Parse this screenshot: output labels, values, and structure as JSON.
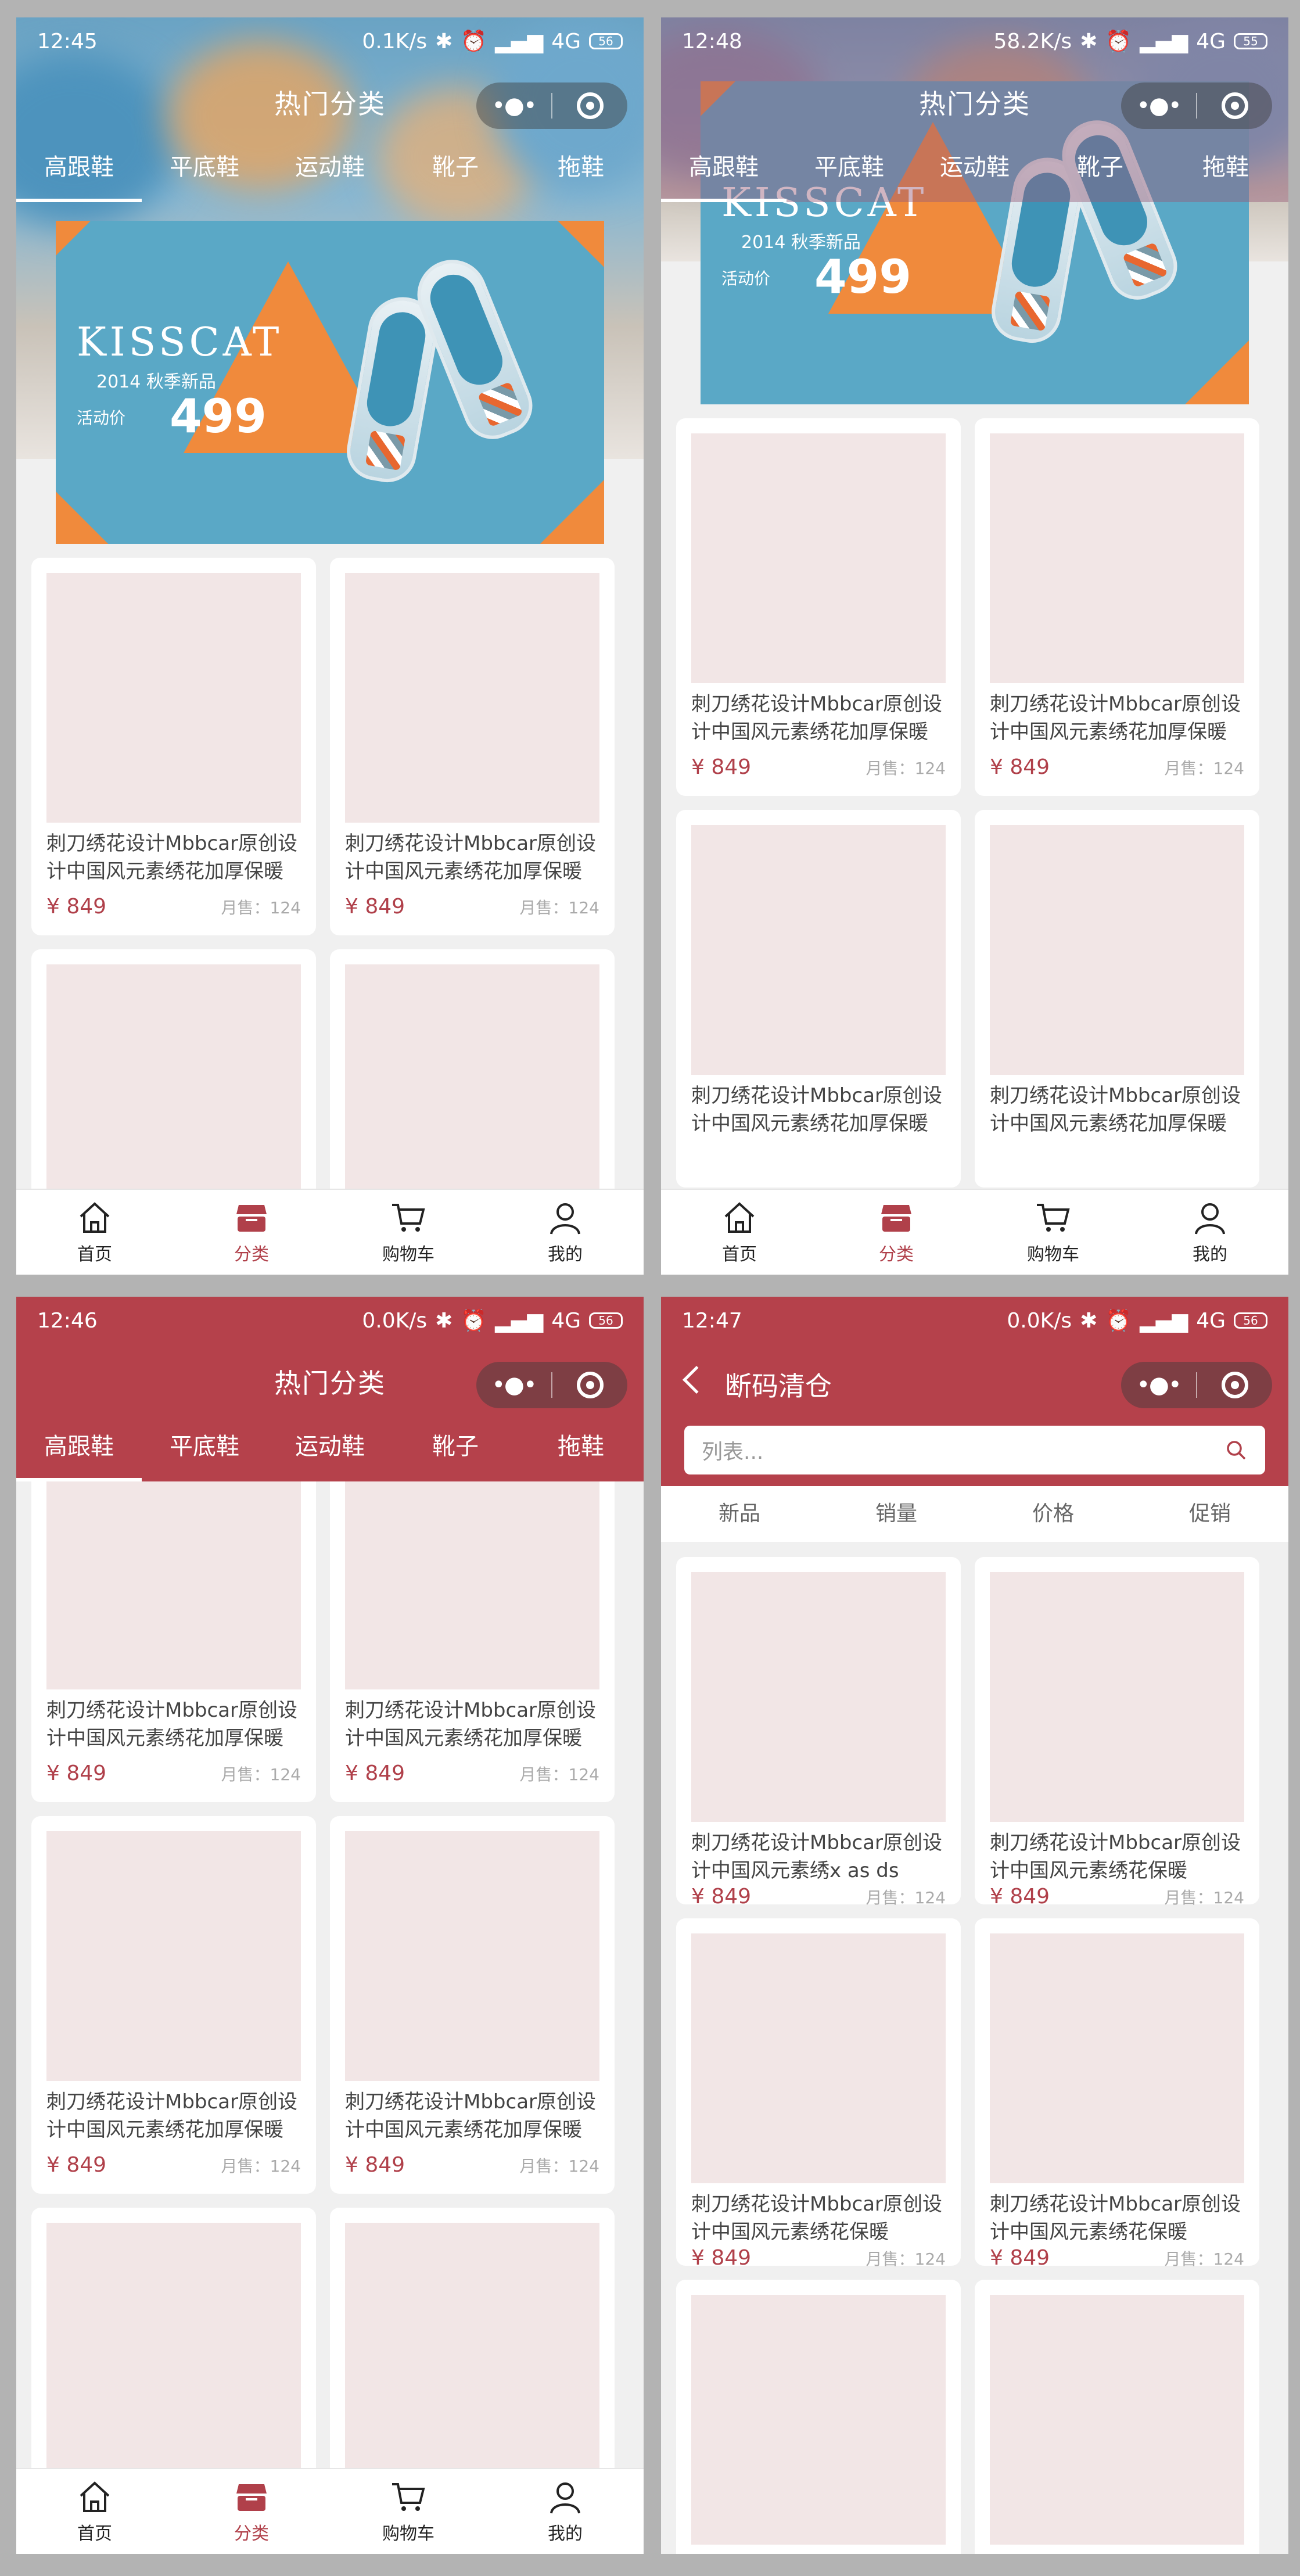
{
  "screens": [
    {
      "status": {
        "time": "12:45",
        "speed": "0.1K/s",
        "signal": "4G",
        "battery": "56"
      },
      "title": "热门分类",
      "tabs": [
        "高跟鞋",
        "平底鞋",
        "运动鞋",
        "靴子",
        "拖鞋"
      ],
      "banner": {
        "brand": "KISSCAT",
        "season": "2014 秋季新品",
        "price_label": "活动价",
        "price": "499"
      }
    },
    {
      "status": {
        "time": "12:48",
        "speed": "58.2K/s",
        "signal": "4G",
        "battery": "55"
      },
      "title": "热门分类",
      "tabs": [
        "高跟鞋",
        "平底鞋",
        "运动鞋",
        "靴子",
        "拖鞋"
      ],
      "banner": {
        "brand": "KISSCAT",
        "season": "2014 秋季新品",
        "price_label": "活动价",
        "price": "499"
      }
    },
    {
      "status": {
        "time": "12:46",
        "speed": "0.0K/s",
        "signal": "4G",
        "battery": "56"
      },
      "title": "热门分类",
      "tabs": [
        "高跟鞋",
        "平底鞋",
        "运动鞋",
        "靴子",
        "拖鞋"
      ]
    },
    {
      "status": {
        "time": "12:47",
        "speed": "0.0K/s",
        "signal": "4G",
        "battery": "56"
      },
      "title": "断码清仓",
      "search_placeholder": "列表...",
      "sort": [
        "新品",
        "销量",
        "价格",
        "促销"
      ]
    }
  ],
  "product": {
    "name": "刺刀绣花设计Mbbcar原创设计中国风元素绣花加厚保暖",
    "name_alt1": "刺刀绣花设计Mbbcar原创设计中国风元素绣x as ds",
    "name_alt2": "刺刀绣花设计Mbbcar原创设计中国风元素绣花保暖",
    "price": "¥ 849",
    "sold": "月售：124"
  },
  "tabbar": [
    "首页",
    "分类",
    "购物车",
    "我的"
  ],
  "colors": {
    "accent": "#b5414b",
    "price": "#b0404a",
    "placeholder": "#f2e6e6",
    "banner": "#5aa8c6",
    "orange": "#f08a3c"
  }
}
